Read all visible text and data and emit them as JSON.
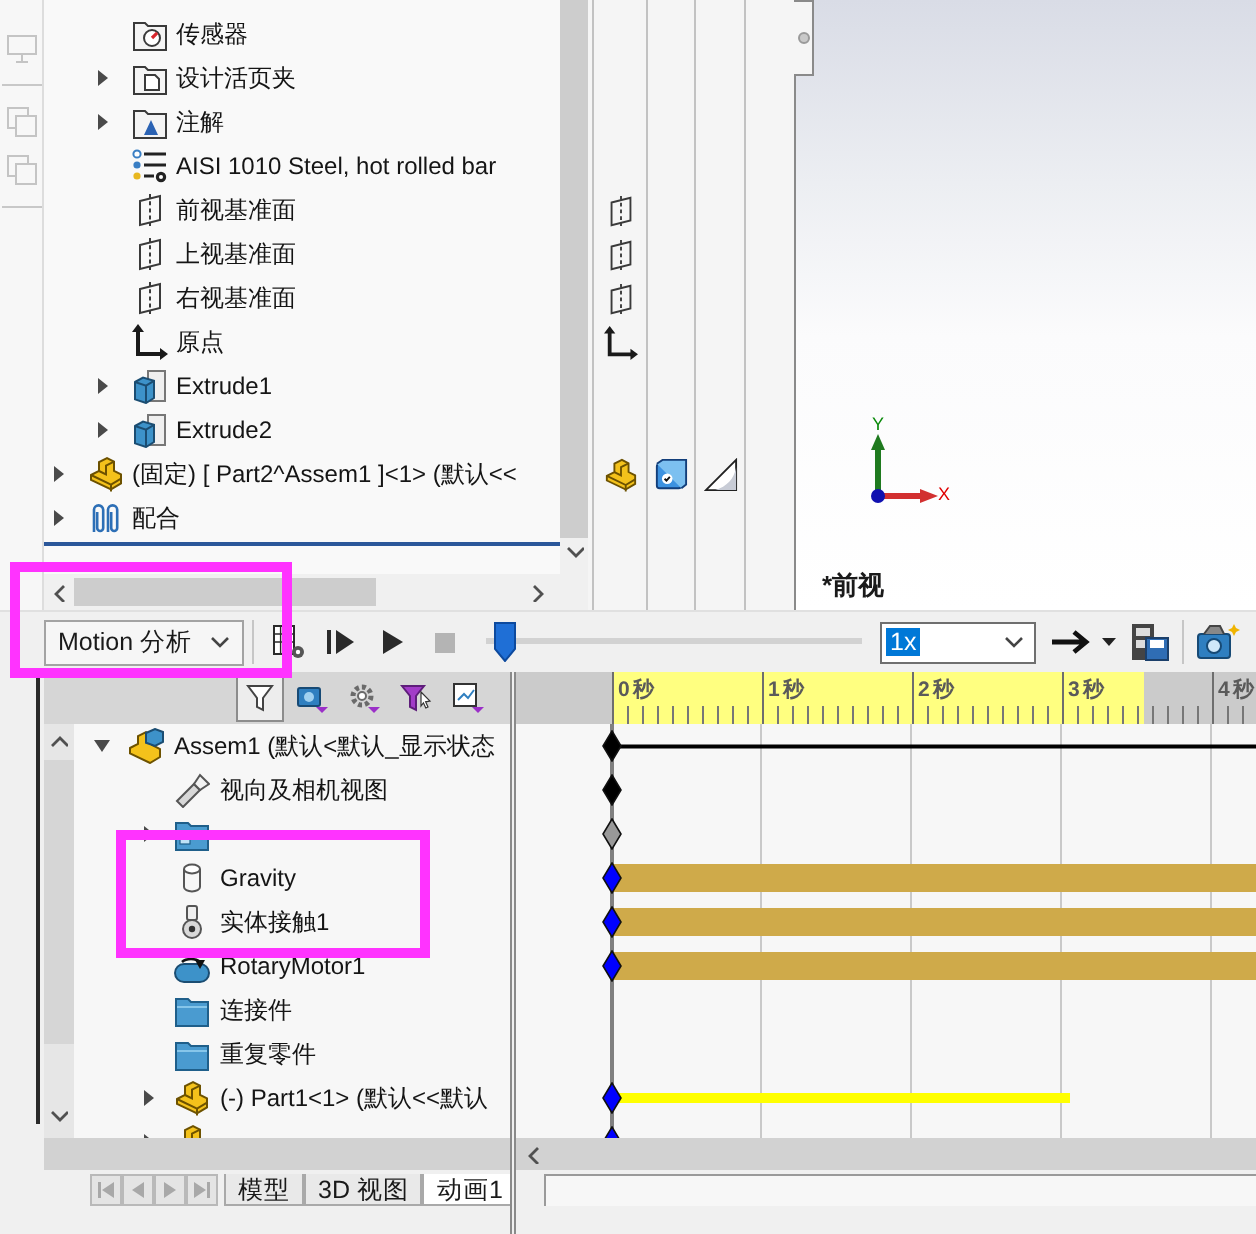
{
  "feature_tree": {
    "items": [
      {
        "children": [
          {
            "kind": "sensor",
            "label": "传感器"
          },
          {
            "kind": "binder",
            "label": "设计活页夹",
            "expanded": false
          },
          {
            "kind": "annotation",
            "label": "注解",
            "expanded": false
          },
          {
            "kind": "material",
            "label": "AISI 1010 Steel, hot rolled bar"
          },
          {
            "kind": "plane",
            "label": "前视基准面"
          },
          {
            "kind": "plane",
            "label": "上视基准面"
          },
          {
            "kind": "plane",
            "label": "右视基准面"
          },
          {
            "kind": "origin",
            "label": "原点"
          },
          {
            "kind": "feature",
            "label": "Extrude1",
            "expanded": false
          },
          {
            "kind": "feature",
            "label": "Extrude2",
            "expanded": false
          }
        ]
      },
      {
        "kind": "part",
        "label": "(固定) [ Part2^Assem1 ]<1> (默认<<",
        "expanded": false
      },
      {
        "kind": "mates",
        "label": "配合",
        "expanded": false
      }
    ]
  },
  "graphics": {
    "triad": {
      "x_label": "X",
      "y_label": "Y"
    },
    "view_label": "*前视"
  },
  "motion_toolbar": {
    "study_type": "Motion 分析",
    "buttons": [
      {
        "kind": "calculate",
        "disabled": false
      },
      {
        "kind": "play-from-start",
        "disabled": false
      },
      {
        "kind": "play",
        "disabled": false
      },
      {
        "kind": "stop",
        "disabled": true
      }
    ],
    "slider": {
      "level": 0
    },
    "speed": {
      "value": "1x",
      "highlighted": true
    },
    "tools": [
      {
        "kind": "playback-mode"
      },
      {
        "kind": "mode-menu"
      },
      {
        "kind": "save-animation"
      },
      {
        "kind": "animation-wizard"
      }
    ]
  },
  "motion_manager": {
    "filters": [
      {
        "kind": "animated",
        "selected": true
      },
      {
        "kind": "camera",
        "selected": false
      },
      {
        "kind": "gear",
        "selected": false
      },
      {
        "kind": "funnel",
        "selected": false
      },
      {
        "kind": "graph",
        "selected": false
      }
    ],
    "tree": [
      {
        "kind": "assembly",
        "label": "Assem1 (默认<默认_显示状态",
        "expanded": true,
        "key": {
          "color": "#000000"
        },
        "bar": {
          "kind": "line",
          "color": "#000000",
          "level": 1
        },
        "children": [
          {
            "kind": "camera",
            "label": "视向及相机视图",
            "key": {
              "color": "#000000"
            }
          },
          {
            "kind": "lights",
            "expanded": false,
            "key": {
              "color": "#999999"
            }
          },
          {
            "kind": "gravity",
            "label": "Gravity",
            "key": {
              "color": "#0000ff"
            },
            "bar": {
              "kind": "band",
              "color": "#cfaa4a",
              "level": 1
            }
          },
          {
            "kind": "contact",
            "label": "实体接触1",
            "key": {
              "color": "#0000ff"
            },
            "bar": {
              "kind": "band",
              "color": "#cfaa4a",
              "level": 1
            }
          },
          {
            "kind": "motor",
            "label": "RotaryMotor1",
            "key": {
              "color": "#0000ff"
            },
            "bar": {
              "kind": "band",
              "color": "#cfaa4a",
              "level": 1
            }
          },
          {
            "kind": "folder",
            "label": "连接件"
          },
          {
            "kind": "folder",
            "label": "重复零件"
          },
          {
            "kind": "part",
            "label": "(-) Part1<1> (默认<<默认",
            "expanded": false,
            "key": {
              "color": "#0000ff"
            },
            "bar": {
              "kind": "strip",
              "color": "#ffff00",
              "level": 0.71
            }
          },
          {
            "kind": "part",
            "expanded": false,
            "key": {
              "color": "#0000ff"
            }
          }
        ]
      }
    ],
    "tabs": [
      {
        "label": "模型",
        "selected": false
      },
      {
        "label": "3D 视图",
        "selected": false
      },
      {
        "label": "动画1",
        "selected": true
      }
    ]
  },
  "timeline": {
    "ruler": {
      "labels": [
        "0 秒",
        "1 秒",
        "2 秒",
        "3 秒",
        "4 秒"
      ],
      "level": 0.71
    }
  }
}
